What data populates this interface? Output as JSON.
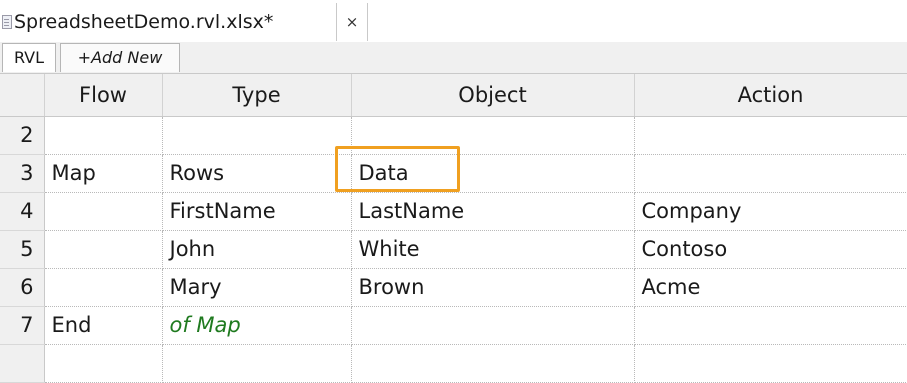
{
  "document_tab": {
    "title": "SpreadsheetDemo.rvl.xlsx*",
    "close_glyph": "×"
  },
  "sheet_tabs": [
    {
      "label": "RVL"
    },
    {
      "label": "+Add New"
    }
  ],
  "columns": [
    "Flow",
    "Type",
    "Object",
    "Action"
  ],
  "rows": [
    {
      "num": "2",
      "flow": "",
      "type": "",
      "object": "",
      "action": ""
    },
    {
      "num": "3",
      "flow": "Map",
      "type": "Rows",
      "object": "Data",
      "action": ""
    },
    {
      "num": "4",
      "flow": "",
      "type": "FirstName",
      "object": "LastName",
      "action": "Company"
    },
    {
      "num": "5",
      "flow": "",
      "type": "John",
      "object": "White",
      "action": "Contoso"
    },
    {
      "num": "6",
      "flow": "",
      "type": "Mary",
      "object": "Brown",
      "action": "Acme"
    },
    {
      "num": "7",
      "flow": "End",
      "type": "of Map",
      "object": "",
      "action": ""
    },
    {
      "num": "",
      "flow": "",
      "type": "",
      "object": "",
      "action": ""
    }
  ],
  "colors": {
    "highlight": "#f0a020",
    "comment_text": "#1f7a1f",
    "header_bg": "#f0f0f0"
  },
  "icons": {
    "file": "file-icon",
    "close": "close-icon"
  }
}
